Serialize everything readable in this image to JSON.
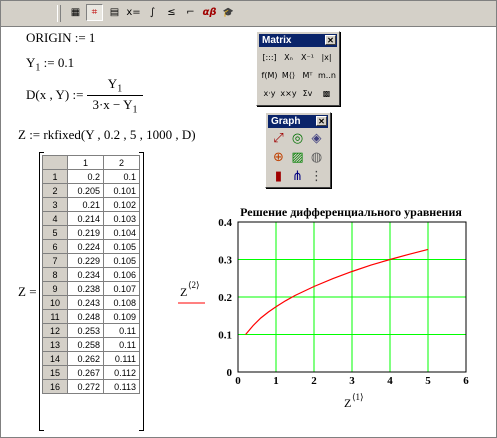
{
  "toolbar": {
    "buttons": [
      {
        "name": "calculator-icon",
        "glyph": "▦"
      },
      {
        "name": "graph-icon",
        "glyph": "⌗"
      },
      {
        "name": "matrix-icon",
        "glyph": "▤"
      },
      {
        "name": "evaluation-icon",
        "glyph": "x="
      },
      {
        "name": "calculus-icon",
        "glyph": "∫"
      },
      {
        "name": "boolean-icon",
        "glyph": "≤"
      },
      {
        "name": "programming-icon",
        "glyph": "⌐"
      },
      {
        "name": "greek-icon",
        "glyph": "αβ"
      },
      {
        "name": "symbolic-icon",
        "glyph": "🎓"
      }
    ]
  },
  "worksheet": {
    "origin": "ORIGIN := 1",
    "y1_name": "Y",
    "y1_sub": "1",
    "y1_rest": " := 0.1",
    "d_lhs": "D(x , Y) :=",
    "d_num": "Y",
    "d_num_sub": "1",
    "d_den": "3·x − Y",
    "d_den_sub": "1",
    "z_def": "Z := rkfixed(Y , 0.2 , 5 , 1000 , D)",
    "z_lhs": "Z ="
  },
  "matrix_palette": {
    "title": "Matrix",
    "buttons": [
      "[:::]",
      "Xₙ",
      "X⁻¹",
      "|x|",
      "f(M)",
      "M⟨⟩",
      "Mᵀ",
      "m..n",
      "x·y",
      "x×y",
      "Σv",
      "▩"
    ]
  },
  "graph_palette": {
    "title": "Graph",
    "buttons": [
      "xy-plot-icon",
      "polar-plot-icon",
      "surface-plot-icon",
      "contour-plot-icon",
      "3d-bar-icon",
      "scatter-3d-icon",
      "bar-plot-icon",
      "vector-field-icon",
      "zoom-icon"
    ]
  },
  "table": {
    "columns": [
      "1",
      "2"
    ],
    "rows": [
      [
        "1",
        "0.2",
        "0.1"
      ],
      [
        "2",
        "0.205",
        "0.101"
      ],
      [
        "3",
        "0.21",
        "0.102"
      ],
      [
        "4",
        "0.214",
        "0.103"
      ],
      [
        "5",
        "0.219",
        "0.104"
      ],
      [
        "6",
        "0.224",
        "0.105"
      ],
      [
        "7",
        "0.229",
        "0.105"
      ],
      [
        "8",
        "0.234",
        "0.106"
      ],
      [
        "9",
        "0.238",
        "0.107"
      ],
      [
        "10",
        "0.243",
        "0.108"
      ],
      [
        "11",
        "0.248",
        "0.109"
      ],
      [
        "12",
        "0.253",
        "0.11"
      ],
      [
        "13",
        "0.258",
        "0.11"
      ],
      [
        "14",
        "0.262",
        "0.111"
      ],
      [
        "15",
        "0.267",
        "0.112"
      ],
      [
        "16",
        "0.272",
        "0.113"
      ]
    ]
  },
  "chart_data": {
    "type": "line",
    "title": "Решение дифференциального уравнения",
    "xlabel": "Z",
    "xlabel_sup": "⟨1⟩",
    "ylabel": "Z",
    "ylabel_sup": "⟨2⟩",
    "xlim": [
      0,
      6
    ],
    "ylim": [
      0,
      0.4
    ],
    "xticks": [
      "0",
      "1",
      "2",
      "3",
      "4",
      "5",
      "6"
    ],
    "yticks": [
      "0",
      "0.1",
      "0.2",
      "0.3",
      "0.4"
    ],
    "grid": true,
    "grid_color": "#00ff00",
    "line_color": "#ff0000",
    "series": [
      {
        "x": [
          0.2,
          0.4,
          0.6,
          0.8,
          1.0,
          1.25,
          1.5,
          2.0,
          2.5,
          3.0,
          3.5,
          4.0,
          4.5,
          5.0
        ],
        "y": [
          0.1,
          0.124,
          0.144,
          0.16,
          0.174,
          0.19,
          0.204,
          0.228,
          0.249,
          0.268,
          0.285,
          0.3,
          0.314,
          0.327
        ]
      }
    ]
  }
}
